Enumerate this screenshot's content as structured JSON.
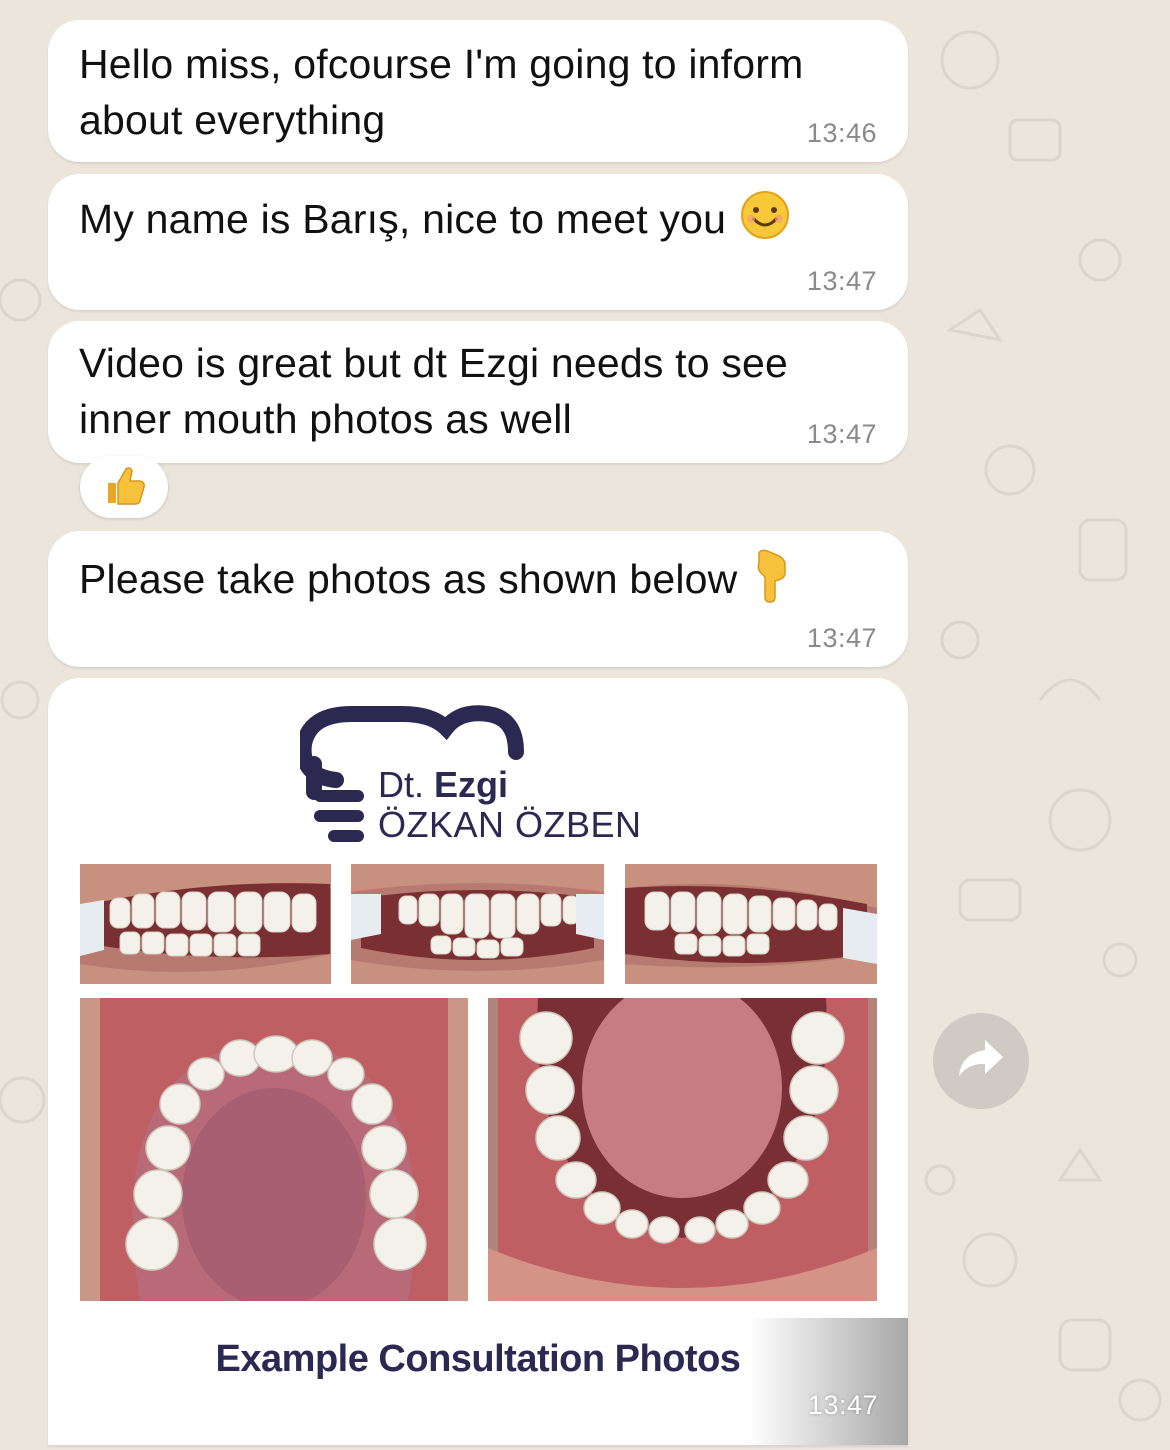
{
  "messages": [
    {
      "text": "Hello miss, ofcourse I'm going to inform about everything",
      "time": "13:46"
    },
    {
      "text": "My name is Barış, nice to meet you",
      "emoji": "smiling-face",
      "time": "13:47"
    },
    {
      "text": "Video is great but dt Ezgi needs to see inner mouth photos as well",
      "time": "13:47",
      "reaction": "thumbs-up"
    },
    {
      "text": "Please take photos as shown below",
      "emoji": "backhand-index-pointing-down",
      "time": "13:47"
    }
  ],
  "image_message": {
    "logo_prefix": "Dt.",
    "logo_first": "Ezgi",
    "logo_name": "ÖZKAN ÖZBEN",
    "caption": "Example Consultation Photos",
    "time": "13:47"
  },
  "forward_button": {
    "icon": "forward-icon"
  },
  "colors": {
    "bubble": "#ffffff",
    "background": "#ebe5dc",
    "brand": "#2b2852",
    "time": "#8a8a8a"
  }
}
